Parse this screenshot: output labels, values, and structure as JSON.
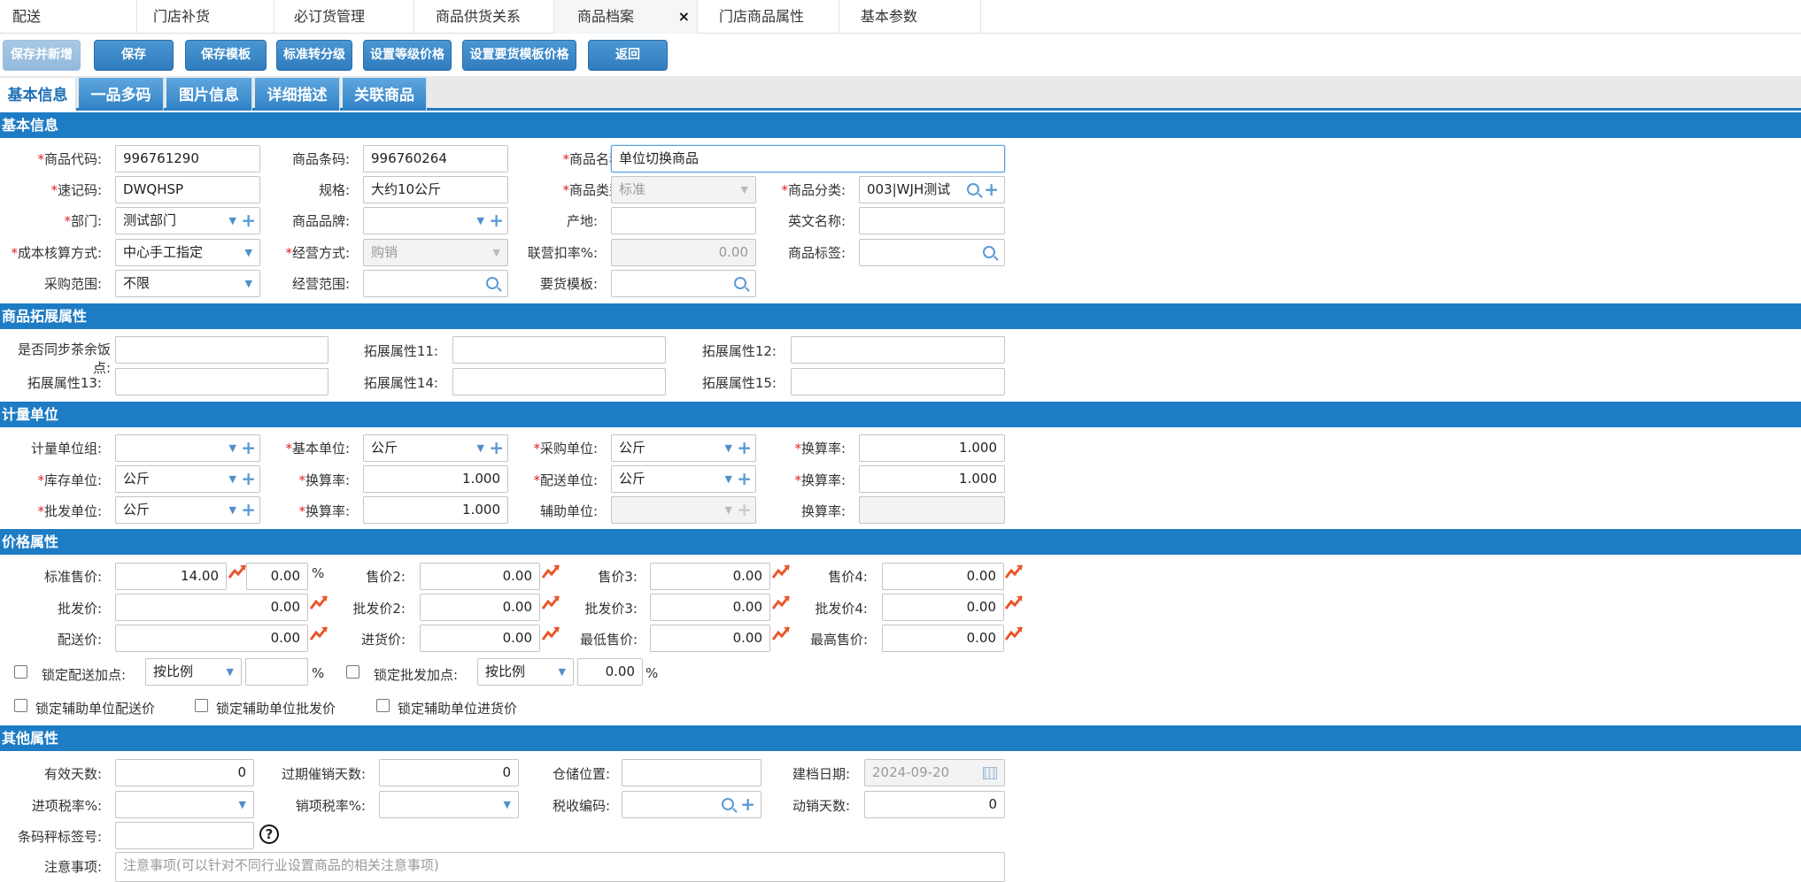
{
  "page_tabs": [
    {
      "label": "配送"
    },
    {
      "label": "门店补货"
    },
    {
      "label": "必订货管理"
    },
    {
      "label": "商品供货关系"
    },
    {
      "label": "商品档案"
    },
    {
      "label": "门店商品属性"
    },
    {
      "label": "基本参数"
    }
  ],
  "active_tab_close": "×",
  "toolbar": {
    "save_and_new": "保存并新增",
    "save": "保存",
    "save_template": "保存模板",
    "std_to_grade": "标准转分级",
    "set_grade_price": "设置等级价格",
    "set_order_template_price": "设置要货模板价格",
    "back": "返回"
  },
  "form_tabs": [
    "基本信息",
    "一品多码",
    "图片信息",
    "详细描述",
    "关联商品"
  ],
  "sections": {
    "basic": "基本信息",
    "ext": "商品拓展属性",
    "unit": "计量单位",
    "price": "价格属性",
    "other": "其他属性"
  },
  "required_mark": "*",
  "basic": {
    "code_label": "商品代码:",
    "code": "996761290",
    "barcode_label": "商品条码:",
    "barcode": "996760264",
    "name_label": "商品名称:",
    "name": "单位切换商品",
    "mnemonic_label": "速记码:",
    "mnemonic": "DWQHSP",
    "spec_label": "规格:",
    "spec": "大约10公斤",
    "type_label": "商品类型:",
    "type": "标准",
    "category_label": "商品分类:",
    "category": "003|WJH测试",
    "dept_label": "部门:",
    "dept": "测试部门",
    "brand_label": "商品品牌:",
    "brand": "",
    "origin_label": "产地:",
    "origin": "",
    "en_name_label": "英文名称:",
    "en_name": "",
    "cost_method_label": "成本核算方式:",
    "cost_method": "中心手工指定",
    "biz_mode_label": "经营方式:",
    "biz_mode": "购销",
    "joint_rate_label": "联营扣率%:",
    "joint_rate": "0.00",
    "tag_label": "商品标签:",
    "tag": "",
    "purchase_scope_label": "采购范围:",
    "purchase_scope": "不限",
    "biz_scope_label": "经营范围:",
    "biz_scope": "",
    "order_template_label": "要货模板:",
    "order_template": ""
  },
  "ext": {
    "sync_label": "是否同步茶余饭点:",
    "attr11_label": "拓展属性11:",
    "attr12_label": "拓展属性12:",
    "attr13_label": "拓展属性13:",
    "attr14_label": "拓展属性14:",
    "attr15_label": "拓展属性15:"
  },
  "unit": {
    "group_label": "计量单位组:",
    "group": "",
    "base_label": "基本单位:",
    "base": "公斤",
    "purchase_label": "采购单位:",
    "purchase": "公斤",
    "rate1_label": "换算率:",
    "rate1": "1.000",
    "stock_label": "库存单位:",
    "stock": "公斤",
    "rate2_label": "换算率:",
    "rate2": "1.000",
    "delivery_label": "配送单位:",
    "delivery": "公斤",
    "rate3_label": "换算率:",
    "rate3": "1.000",
    "wholesale_label": "批发单位:",
    "wholesale": "公斤",
    "rate4_label": "换算率:",
    "rate4": "1.000",
    "aux_label": "辅助单位:",
    "aux": "",
    "rate5_label": "换算率:",
    "rate5": ""
  },
  "price": {
    "std_label": "标准售价:",
    "std": "14.00",
    "std_pct": "0.00",
    "pct_sign": "%",
    "p2_label": "售价2:",
    "p2": "0.00",
    "p3_label": "售价3:",
    "p3": "0.00",
    "p4_label": "售价4:",
    "p4": "0.00",
    "w1_label": "批发价:",
    "w1": "0.00",
    "w2_label": "批发价2:",
    "w2": "0.00",
    "w3_label": "批发价3:",
    "w3": "0.00",
    "w4_label": "批发价4:",
    "w4": "0.00",
    "d_label": "配送价:",
    "d": "0.00",
    "in_label": "进货价:",
    "in": "0.00",
    "min_label": "最低售价:",
    "min": "0.00",
    "max_label": "最高售价:",
    "max": "0.00",
    "lock_delivery_markup": "锁定配送加点:",
    "lock_delivery_mode": "按比例",
    "lock_delivery_pct": "",
    "lock_wholesale_markup": "锁定批发加点:",
    "lock_wholesale_mode": "按比例",
    "lock_wholesale_pct": "0.00",
    "lock_aux_delivery": "锁定辅助单位配送价",
    "lock_aux_wholesale": "锁定辅助单位批发价",
    "lock_aux_purchase": "锁定辅助单位进货价"
  },
  "other": {
    "valid_days_label": "有效天数:",
    "valid_days": "0",
    "expire_days_label": "过期催销天数:",
    "expire_days": "0",
    "location_label": "仓储位置:",
    "location": "",
    "created_label": "建档日期:",
    "created": "2024-09-20",
    "in_tax_label": "进项税率%:",
    "in_tax": "",
    "out_tax_label": "销项税率%:",
    "out_tax": "",
    "tax_code_label": "税收编码:",
    "tax_code": "",
    "sales_days_label": "动销天数:",
    "sales_days": "0",
    "scale_label": "条码秤标签号:",
    "scale": "",
    "help": "?",
    "notes_label": "注意事项:",
    "notes_placeholder": "注意事项(可以针对不同行业设置商品的相关注意事项)"
  }
}
